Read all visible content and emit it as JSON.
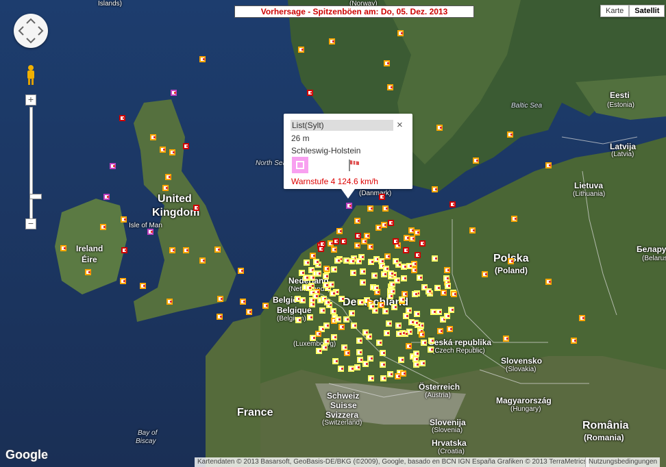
{
  "header": {
    "title": "Vorhersage - Spitzenböen am: Do, 05. Dez. 2013"
  },
  "map_type": {
    "map_label": "Karte",
    "satellite_label": "Satellit"
  },
  "zoom": {
    "plus": "+",
    "minus": "−"
  },
  "popup": {
    "title": "List(Sylt)",
    "close": "×",
    "altitude": "26 m",
    "region": "Schleswig-Holstein",
    "warning": "Warnstufe 4   124.6  km/h"
  },
  "labels": {
    "islands": "Islands)",
    "uk_top": "United",
    "uk_bottom": "Kingdom",
    "isle_of_man": "Isle of Man",
    "ireland": "Ireland",
    "eire": "Éire",
    "north_sea": "North Sea",
    "baltic_sea": "Baltic Sea",
    "denmark": "(Danmark)",
    "eesti": "Eesti",
    "estonia": "(Estonia)",
    "latvija": "Latvija",
    "latvia": "(Latvia)",
    "lietuva": "Lietuva",
    "lithuania": "(Lithuania)",
    "belarus": "Беларус",
    "belarus_en": "(Belarus)",
    "polska": "Polska",
    "poland": "(Poland)",
    "nederland": "Nederland",
    "netherlands": "(Netherlands)",
    "belgie": "België",
    "belgique": "Belgique",
    "belgium": "(Belgium)",
    "deutschland": "Deutschland",
    "luxembourg": "(Luxembourg)",
    "cesko": "Česká republika",
    "czech": "(Czech Republic)",
    "slovensko": "Slovensko",
    "slovakia": "(Slovakia)",
    "osterreich": "Österreich",
    "austria": "(Austria)",
    "schweiz": "Schweiz",
    "suisse": "Suisse",
    "svizzera": "Svizzera",
    "switzerland": "(Switzerland)",
    "france": "France",
    "magyar": "Magyarország",
    "hungary": "(Hungary)",
    "slovenija": "Slovenija",
    "slovenia": "(Slovenia)",
    "hrvatska": "Hrvatska",
    "croatia": "(Croatia)",
    "romania": "România",
    "romania_en": "(Romania)",
    "bay": "Bay of",
    "biscay": "Biscay",
    "norway": "(Norway)"
  },
  "footer": {
    "logo": "Google",
    "attribution": "Kartendaten © 2013 Basarsoft, GeoBasis-DE/BKG (©2009), Google, basado en BCN IGN España Grafiken © 2013 TerraMetrics",
    "terms": "Nutzungsbedingungen"
  },
  "colors": {
    "warn1": "#ffff66",
    "warn2": "#ffa500",
    "warn3": "#d00000",
    "warn4": "#c040c0",
    "title_text": "#cc0000"
  }
}
